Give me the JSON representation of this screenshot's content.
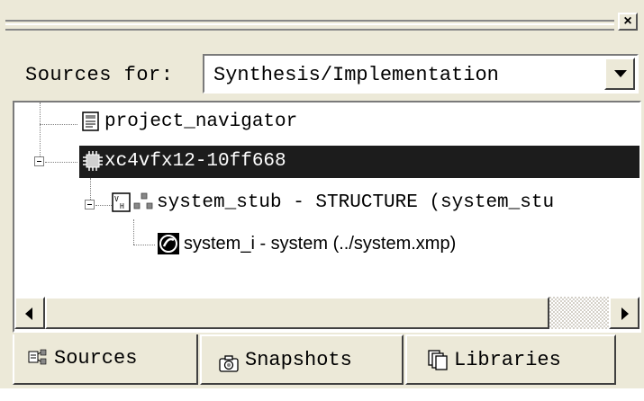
{
  "panel": {
    "close_glyph": "×"
  },
  "sources_for": {
    "label": "Sources for:",
    "selected": "Synthesis/Implementation"
  },
  "tree": {
    "nodes": [
      {
        "label": "project_navigator",
        "icon": "document-icon"
      },
      {
        "label": "xc4vfx12-10ff668",
        "icon": "chip-icon",
        "selected": true
      },
      {
        "label": "system_stub - STRUCTURE (system_stu",
        "icon": "vhdl-module-icon"
      },
      {
        "label": "system_i - system (../system.xmp)",
        "icon": "xps-project-icon"
      }
    ]
  },
  "tabs": [
    {
      "label": "Sources",
      "icon": "sources-tree-icon",
      "active": true
    },
    {
      "label": "Snapshots",
      "icon": "camera-icon",
      "active": false
    },
    {
      "label": "Libraries",
      "icon": "libraries-icon",
      "active": false
    }
  ],
  "colors": {
    "selection_bg": "#1c1c1c",
    "selection_fg": "#ffffff",
    "panel_bg": "#ece9d8"
  }
}
